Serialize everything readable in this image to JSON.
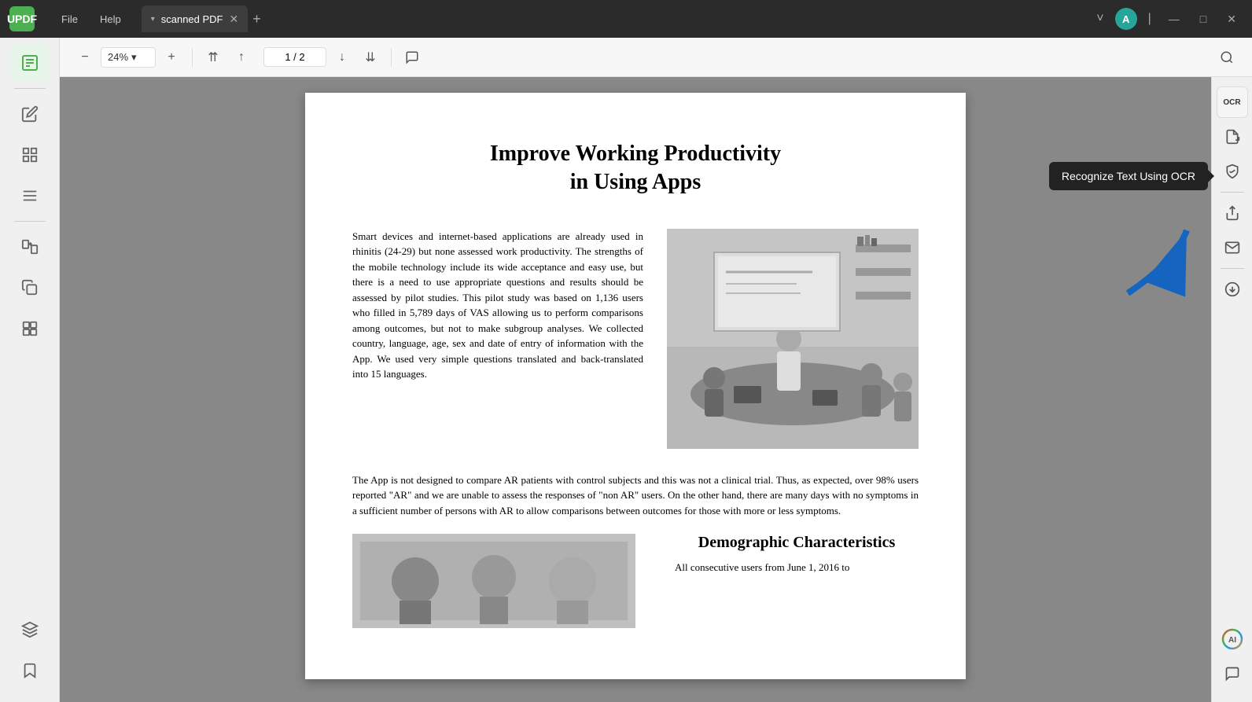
{
  "titlebar": {
    "logo_text": "UPDF",
    "menu_items": [
      "File",
      "Help"
    ],
    "tab_name": "scanned PDF",
    "tab_dropdown_label": "▾",
    "tab_close_label": "✕",
    "tab_add_label": "+",
    "avatar_letter": "A",
    "window_minimize": "—",
    "window_maximize": "□",
    "window_close": "✕",
    "chevron_down": "˅"
  },
  "toolbar": {
    "zoom_out_label": "−",
    "zoom_in_label": "+",
    "zoom_value": "24%",
    "zoom_dropdown": "▾",
    "nav_first_label": "⇈",
    "nav_prev_label": "↑",
    "nav_next_label": "↓",
    "nav_last_label": "⇊",
    "page_current": "1",
    "page_total": "2",
    "page_separator": "/",
    "comment_label": "💬",
    "search_label": "🔍"
  },
  "left_sidebar": {
    "icons": [
      {
        "name": "reader-icon",
        "symbol": "📄",
        "active": true
      },
      {
        "name": "edit-icon",
        "symbol": "✏️",
        "active": false
      },
      {
        "name": "organize-icon",
        "symbol": "≡",
        "active": false
      },
      {
        "name": "convert-icon",
        "symbol": "⇄",
        "active": false
      },
      {
        "name": "copy-icon",
        "symbol": "⊕",
        "active": false
      },
      {
        "name": "stamp-icon",
        "symbol": "⊞",
        "active": false
      },
      {
        "name": "layers-icon",
        "symbol": "⧉",
        "active": false
      },
      {
        "name": "bookmark-icon",
        "symbol": "🔖",
        "active": false
      }
    ]
  },
  "right_sidebar": {
    "icons": [
      {
        "name": "ocr-icon",
        "symbol": "OCR"
      },
      {
        "name": "convert-pdf-icon",
        "symbol": "↗"
      },
      {
        "name": "protect-icon",
        "symbol": "🔒"
      },
      {
        "name": "share-icon",
        "symbol": "↑"
      },
      {
        "name": "email-icon",
        "symbol": "✉"
      },
      {
        "name": "compress-icon",
        "symbol": "⊙"
      },
      {
        "name": "ai-icon",
        "symbol": "✦"
      },
      {
        "name": "chat-icon",
        "symbol": "💬"
      }
    ]
  },
  "ocr_tooltip": {
    "label": "Recognize Text Using OCR"
  },
  "pdf": {
    "title_line1": "Improve Working Productivity",
    "title_line2": "in Using Apps",
    "paragraph1": "Smart devices and internet-based applications are already used in rhinitis (24-29) but none assessed work productivity. The strengths of the mobile technology include its wide acceptance and easy use, but there is a need to use appropriate questions and results should be assessed by pilot studies. This pilot study was based on 1,136 users who filled in 5,789 days of VAS allowing us to perform comparisons among outcomes, but not to make subgroup analyses. We collected country, language, age, sex and date of entry of information with the App. We used very simple questions translated and back-translated into 15 languages.",
    "paragraph2": "The App is not designed to compare AR patients with control subjects and this was not a clinical trial. Thus, as expected, over 98% users reported \"AR\" and we are unable to assess the responses of \"non AR\" users. On the other hand, there are many days with no symptoms in a sufficient number of persons with AR to allow comparisons between outcomes for those with more or less symptoms.",
    "subtitle": "Demographic Characteristics",
    "paragraph3": "All consecutive users from June 1, 2016 to"
  }
}
